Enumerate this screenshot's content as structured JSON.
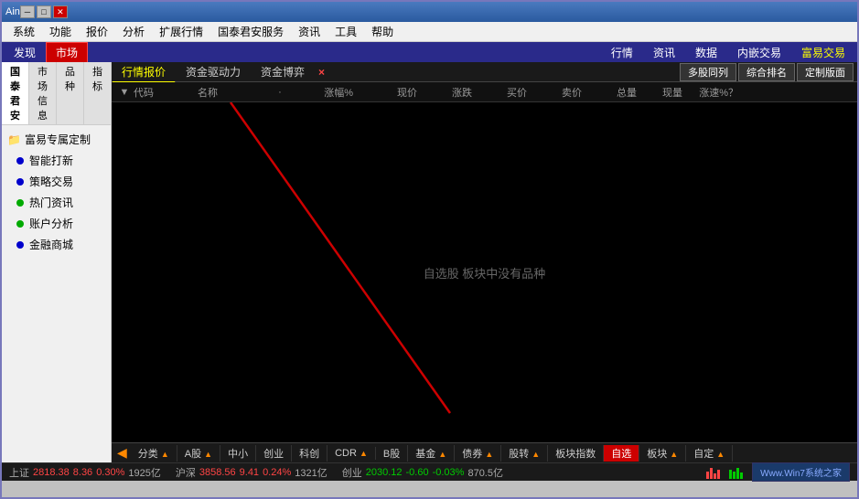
{
  "titleBar": {
    "title": "Ain",
    "btnMin": "─",
    "btnMax": "□",
    "btnClose": "✕"
  },
  "menuBar": {
    "items": [
      {
        "id": "system",
        "label": "系统"
      },
      {
        "id": "function",
        "label": "功能"
      },
      {
        "id": "quote",
        "label": "报价"
      },
      {
        "id": "analysis",
        "label": "分析"
      },
      {
        "id": "extended",
        "label": "扩展行情"
      },
      {
        "id": "guotai",
        "label": "国泰君安服务"
      },
      {
        "id": "info",
        "label": "资讯"
      },
      {
        "id": "tools",
        "label": "工具"
      },
      {
        "id": "help",
        "label": "帮助"
      }
    ]
  },
  "topTabs": {
    "items": [
      {
        "id": "discover",
        "label": "发现"
      },
      {
        "id": "market",
        "label": "市场",
        "active": true
      },
      {
        "id": "xingqing",
        "label": "行情"
      },
      {
        "id": "zixun",
        "label": "资讯"
      },
      {
        "id": "shuju",
        "label": "数据"
      },
      {
        "id": "neicang",
        "label": "内嵌交易"
      },
      {
        "id": "fueasy",
        "label": "富易交易"
      }
    ]
  },
  "sidebar": {
    "tabs": [
      {
        "id": "guotai",
        "label": "国泰君安",
        "active": true
      },
      {
        "id": "market",
        "label": "市场信息"
      },
      {
        "id": "variety",
        "label": "品种"
      },
      {
        "id": "indicator",
        "label": "指标"
      }
    ],
    "groupTitle": "富易专属定制",
    "items": [
      {
        "id": "smart",
        "label": "智能打新",
        "dotColor": "blue"
      },
      {
        "id": "strategy",
        "label": "策略交易",
        "dotColor": "blue"
      },
      {
        "id": "hotinfo",
        "label": "热门资讯",
        "dotColor": "green"
      },
      {
        "id": "account",
        "label": "账户分析",
        "dotColor": "green"
      },
      {
        "id": "finance",
        "label": "金融商城",
        "dotColor": "blue"
      }
    ]
  },
  "secondaryTabs": {
    "items": [
      {
        "id": "quote-price",
        "label": "行情报价",
        "active": true
      },
      {
        "id": "capital-drive",
        "label": "资金驱动力"
      },
      {
        "id": "capital-game",
        "label": "资金博弈"
      }
    ],
    "closeLabel": "×"
  },
  "rightActionButtons": [
    {
      "id": "multi-row",
      "label": "多股同列"
    },
    {
      "id": "comprehensive",
      "label": "综合排名"
    },
    {
      "id": "custom",
      "label": "定制版面"
    }
  ],
  "tableHeader": {
    "cols": [
      {
        "id": "arrow",
        "label": "▼"
      },
      {
        "id": "code",
        "label": "代码"
      },
      {
        "id": "name",
        "label": "名称"
      },
      {
        "id": "dot",
        "label": "·"
      },
      {
        "id": "change-pct",
        "label": "涨幅%"
      },
      {
        "id": "price",
        "label": "现价"
      },
      {
        "id": "change",
        "label": "涨跌"
      },
      {
        "id": "buy",
        "label": "买价"
      },
      {
        "id": "sell",
        "label": "卖价"
      },
      {
        "id": "total",
        "label": "总量"
      },
      {
        "id": "current",
        "label": "现量"
      },
      {
        "id": "speed",
        "label": "涨速%"
      },
      {
        "id": "question",
        "label": "？"
      }
    ]
  },
  "dataArea": {
    "emptyMessage": "自选股 板块中没有品种"
  },
  "bottomTabs": {
    "arrowLeft": "◀",
    "items": [
      {
        "id": "classify",
        "label": "分类",
        "arr": "▲"
      },
      {
        "id": "a-stock",
        "label": "A股",
        "arr": "▲"
      },
      {
        "id": "mid-small",
        "label": "中小"
      },
      {
        "id": "chuangye",
        "label": "创业"
      },
      {
        "id": "kechuang",
        "label": "科创"
      },
      {
        "id": "cdr",
        "label": "CDR",
        "arr": "▲"
      },
      {
        "id": "b-stock",
        "label": "B股"
      },
      {
        "id": "fund",
        "label": "基金",
        "arr": "▲"
      },
      {
        "id": "bond",
        "label": "债券",
        "arr": "▲"
      },
      {
        "id": "stock-transfer",
        "label": "股转",
        "arr": "▲"
      },
      {
        "id": "sector-index",
        "label": "板块指数"
      },
      {
        "id": "custom-select",
        "label": "自选",
        "active": true
      },
      {
        "id": "sector",
        "label": "板块",
        "arr": "▲"
      },
      {
        "id": "custom-define",
        "label": "自定",
        "arr": "▲"
      }
    ]
  },
  "statusBar": {
    "items": [
      {
        "id": "shanghai",
        "label": "上证",
        "index": "2818.38",
        "change": "8.36",
        "changePct": "0.30%",
        "vol": "1925亿",
        "direction": "up"
      },
      {
        "id": "huhu",
        "label": "沪深",
        "index": "3858.56",
        "change": "9.41",
        "changePct": "0.24%",
        "vol": "1321亿",
        "direction": "up"
      },
      {
        "id": "chuangye",
        "label": "创业",
        "index": "2030.12",
        "change": "-0.60",
        "changePct": "-0.03%",
        "vol": "870.5亿",
        "direction": "down"
      }
    ]
  }
}
